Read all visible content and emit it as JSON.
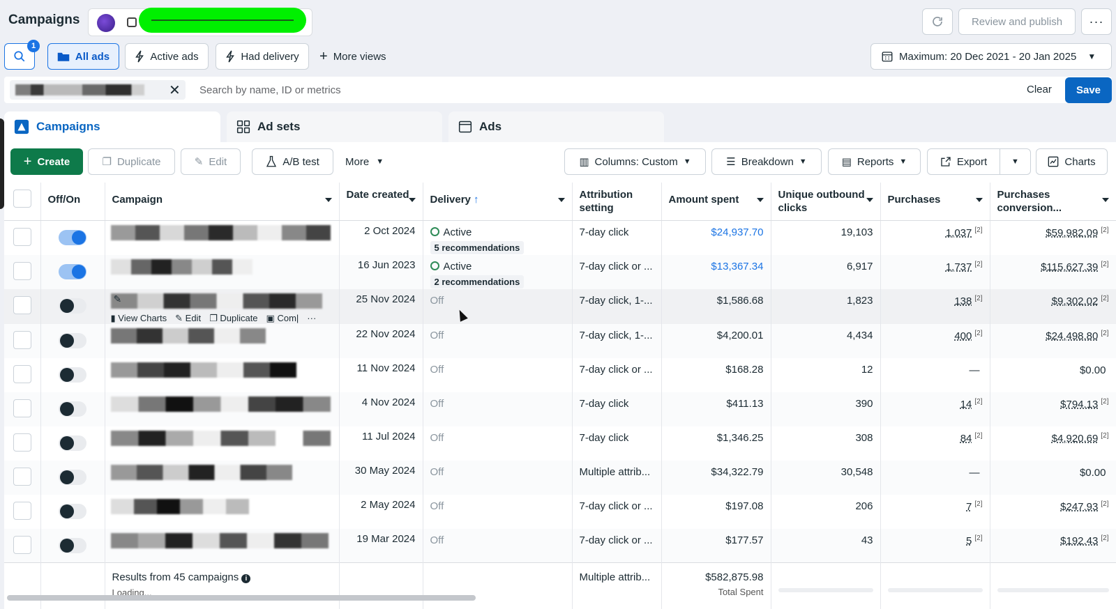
{
  "header": {
    "title": "Campaigns",
    "review_label": "Review and publish",
    "more_label": "···"
  },
  "views": {
    "search_badge": "1",
    "all_ads": "All ads",
    "active_ads": "Active ads",
    "had_delivery": "Had delivery",
    "more_views": "More views",
    "date_range": "Maximum: 20 Dec 2021 - 20 Jan 2025"
  },
  "search": {
    "placeholder": "Search by name, ID or metrics",
    "clear_label": "Clear",
    "save_label": "Save"
  },
  "tabs": [
    {
      "label": "Campaigns"
    },
    {
      "label": "Ad sets"
    },
    {
      "label": "Ads"
    }
  ],
  "toolbar": {
    "create": "Create",
    "duplicate": "Duplicate",
    "edit": "Edit",
    "ab_test": "A/B test",
    "more": "More",
    "columns": "Columns: Custom",
    "breakdown": "Breakdown",
    "reports": "Reports",
    "export": "Export",
    "charts": "Charts"
  },
  "columns": {
    "off_on": "Off/On",
    "campaign": "Campaign",
    "date_created": "Date created",
    "delivery": "Delivery",
    "attribution": "Attribution setting",
    "amount_spent": "Amount spent",
    "unique_clicks": "Unique outbound clicks",
    "purchases": "Purchases",
    "purchases_conv": "Purchases conversion..."
  },
  "row_actions": {
    "view_charts": "View Charts",
    "edit": "Edit",
    "duplicate": "Duplicate",
    "compare": "Com|"
  },
  "rows": [
    {
      "on": true,
      "date": "2 Oct 2024",
      "delivery": "Active",
      "recs": "5 recommendations",
      "attribution": "7-day click",
      "spent": "$24,937.70",
      "clicks": "19,103",
      "purchases": "1,037",
      "ptag": "[2]",
      "conv": "$59,982.09",
      "ctag": "[2]"
    },
    {
      "on": true,
      "date": "16 Jun 2023",
      "delivery": "Active",
      "recs": "2 recommendations",
      "attribution": "7-day click or ...",
      "spent": "$13,367.34",
      "clicks": "6,917",
      "purchases": "1,737",
      "ptag": "[2]",
      "conv": "$115,627.39",
      "ctag": "[2]"
    },
    {
      "on": false,
      "date": "25 Nov 2024",
      "delivery": "Off",
      "recs": "",
      "attribution": "7-day click, 1-...",
      "spent": "$1,586.68",
      "clicks": "1,823",
      "purchases": "138",
      "ptag": "[2]",
      "conv": "$9,302.02",
      "ctag": "[2]"
    },
    {
      "on": false,
      "date": "22 Nov 2024",
      "delivery": "Off",
      "recs": "",
      "attribution": "7-day click, 1-...",
      "spent": "$4,200.01",
      "clicks": "4,434",
      "purchases": "400",
      "ptag": "[2]",
      "conv": "$24,498.80",
      "ctag": "[2]"
    },
    {
      "on": false,
      "date": "11 Nov 2024",
      "delivery": "Off",
      "recs": "",
      "attribution": "7-day click or ...",
      "spent": "$168.28",
      "clicks": "12",
      "purchases": "—",
      "ptag": "",
      "conv": "$0.00",
      "ctag": ""
    },
    {
      "on": false,
      "date": "4 Nov 2024",
      "delivery": "Off",
      "recs": "",
      "attribution": "7-day click",
      "spent": "$411.13",
      "clicks": "390",
      "purchases": "14",
      "ptag": "[2]",
      "conv": "$794.13",
      "ctag": "[2]"
    },
    {
      "on": false,
      "date": "11 Jul 2024",
      "delivery": "Off",
      "recs": "",
      "attribution": "7-day click",
      "spent": "$1,346.25",
      "clicks": "308",
      "purchases": "84",
      "ptag": "[2]",
      "conv": "$4,920.69",
      "ctag": "[2]"
    },
    {
      "on": false,
      "date": "30 May 2024",
      "delivery": "Off",
      "recs": "",
      "attribution": "Multiple attrib...",
      "spent": "$34,322.79",
      "clicks": "30,548",
      "purchases": "—",
      "ptag": "",
      "conv": "$0.00",
      "ctag": ""
    },
    {
      "on": false,
      "date": "2 May 2024",
      "delivery": "Off",
      "recs": "",
      "attribution": "7-day click or ...",
      "spent": "$197.08",
      "clicks": "206",
      "purchases": "7",
      "ptag": "[2]",
      "conv": "$247.93",
      "ctag": "[2]"
    },
    {
      "on": false,
      "date": "19 Mar 2024",
      "delivery": "Off",
      "recs": "",
      "attribution": "7-day click or ...",
      "spent": "$177.57",
      "clicks": "43",
      "purchases": "5",
      "ptag": "[2]",
      "conv": "$192.43",
      "ctag": "[2]"
    }
  ],
  "footer": {
    "results": "Results from 45 campaigns",
    "loading": "Loading...",
    "attribution": "Multiple attrib...",
    "total": "$582,875.98",
    "total_label": "Total Spent"
  },
  "colors": {
    "accent": "#1b74e4",
    "create": "#0e7a4a",
    "active": "#2e8b57"
  }
}
